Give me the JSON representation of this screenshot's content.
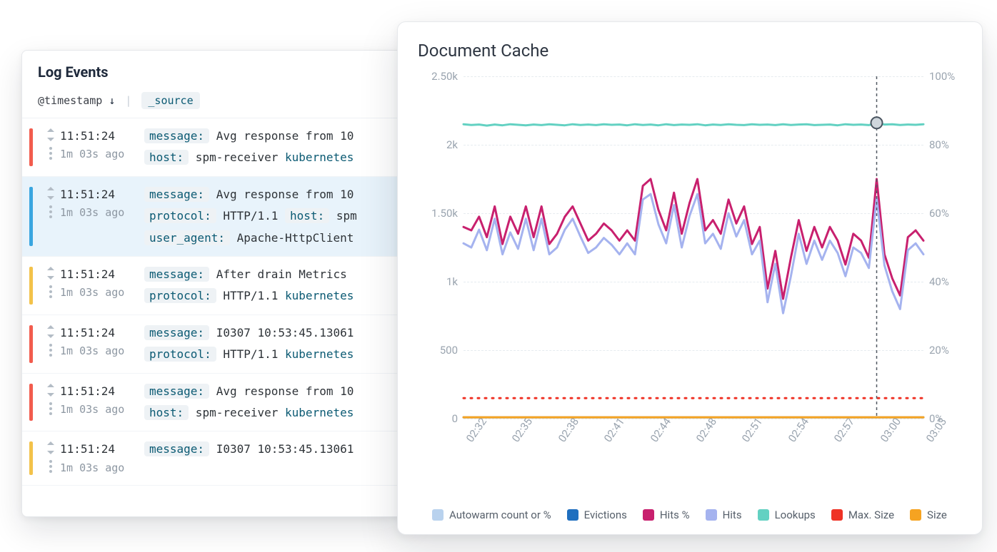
{
  "log_panel": {
    "title": "Log Events",
    "timestamp_label": "@timestamp",
    "sort_arrow": "↓",
    "separator": "|",
    "source_label": "_source",
    "rows": [
      {
        "color": "red",
        "time": "11:51:24",
        "ago": "1m 03s ago",
        "lines": [
          [
            {
              "pill": "message:"
            },
            {
              "text": " Avg response from 10"
            }
          ],
          [
            {
              "pill": "host:"
            },
            {
              "text": " spm-receiver "
            },
            {
              "link": "kubernetes"
            }
          ]
        ]
      },
      {
        "color": "blue",
        "selected": true,
        "time": "11:51:24",
        "ago": "1m 03s ago",
        "lines": [
          [
            {
              "pill": "message:"
            },
            {
              "text": " Avg response from 10"
            }
          ],
          [
            {
              "pill": "protocol:"
            },
            {
              "text": " HTTP/1.1 "
            },
            {
              "pill": "host:"
            },
            {
              "text": " spm"
            }
          ],
          [
            {
              "pill": "user_agent:"
            },
            {
              "text": " Apache-HttpClient"
            }
          ]
        ]
      },
      {
        "color": "yellow",
        "time": "11:51:24",
        "ago": "1m 03s ago",
        "lines": [
          [
            {
              "pill": "message:"
            },
            {
              "text": " After drain Metrics "
            }
          ],
          [
            {
              "pill": "protocol:"
            },
            {
              "text": " HTTP/1.1 "
            },
            {
              "link": "kubernetes"
            }
          ]
        ]
      },
      {
        "color": "red",
        "time": "11:51:24",
        "ago": "1m 03s ago",
        "lines": [
          [
            {
              "pill": "message:"
            },
            {
              "text": " I0307 10:53:45.13061"
            }
          ],
          [
            {
              "pill": "protocol:"
            },
            {
              "text": " HTTP/1.1 "
            },
            {
              "link": "kubernetes"
            }
          ]
        ]
      },
      {
        "color": "red",
        "time": "11:51:24",
        "ago": "1m 03s ago",
        "lines": [
          [
            {
              "pill": "message:"
            },
            {
              "text": " Avg response from 10"
            }
          ],
          [
            {
              "pill": "host:"
            },
            {
              "text": " spm-receiver "
            },
            {
              "link": "kubernetes"
            }
          ]
        ]
      },
      {
        "color": "yellow",
        "time": "11:51:24",
        "ago": "1m 03s ago",
        "lines": [
          [
            {
              "pill": "message:"
            },
            {
              "text": " I0307 10:53:45.13061"
            }
          ]
        ]
      }
    ]
  },
  "chart": {
    "title": "Document Cache",
    "legend": [
      {
        "label": "Autowarm count or %",
        "color": "#b9d2ee"
      },
      {
        "label": "Evictions",
        "color": "#1f6fbf"
      },
      {
        "label": "Hits %",
        "color": "#c8206e"
      },
      {
        "label": "Hits",
        "color": "#a5b3ef"
      },
      {
        "label": "Lookups",
        "color": "#63d1c2"
      },
      {
        "label": "Max. Size",
        "color": "#ef3326"
      },
      {
        "label": "Size",
        "color": "#f6a321"
      }
    ]
  },
  "chart_data": {
    "type": "line",
    "title": "Document Cache",
    "xlabel": "",
    "ylabel_left": "",
    "ylabel_right": "",
    "y1lim": [
      0,
      2500
    ],
    "y2lim": [
      0,
      100
    ],
    "y1_ticks": [
      0,
      500,
      1000,
      1500,
      2000,
      2500
    ],
    "y1_tick_labels": [
      "0",
      "500",
      "1k",
      "1.50k",
      "2k",
      "2.50k"
    ],
    "y2_ticks": [
      0,
      20,
      40,
      60,
      80,
      100
    ],
    "y2_tick_labels": [
      "0%",
      "20%",
      "40%",
      "60%",
      "80%",
      "100%"
    ],
    "x_tick_labels": [
      "02:32",
      "02:35",
      "02:38",
      "02:41",
      "02:44",
      "02:48",
      "02:51",
      "02:54",
      "02:57",
      "03:00",
      "03:03"
    ],
    "cursor_x_index": 53,
    "series": [
      {
        "name": "Lookups",
        "color": "#63d1c2",
        "style": "solid",
        "axis": "left",
        "values": [
          2150,
          2145,
          2148,
          2140,
          2148,
          2142,
          2150,
          2146,
          2142,
          2148,
          2144,
          2150,
          2146,
          2142,
          2150,
          2145,
          2148,
          2144,
          2150,
          2146,
          2148,
          2142,
          2150,
          2145,
          2148,
          2142,
          2150,
          2144,
          2148,
          2146,
          2150,
          2142,
          2148,
          2145,
          2150,
          2146,
          2144,
          2150,
          2146,
          2148,
          2144,
          2150,
          2145,
          2148,
          2150,
          2144,
          2146,
          2148,
          2142,
          2150,
          2146,
          2148,
          2144,
          2160,
          2148,
          2150,
          2145,
          2148,
          2146,
          2150
        ]
      },
      {
        "name": "Hits %",
        "color": "#c8206e",
        "style": "solid",
        "axis": "right",
        "values": [
          56,
          55,
          59,
          53,
          62,
          51,
          59,
          54,
          62,
          53,
          62,
          51,
          54,
          59,
          62,
          57,
          52,
          54,
          57,
          55,
          52,
          55,
          52,
          68,
          70,
          61,
          55,
          66,
          54,
          63,
          70,
          55,
          58,
          54,
          64,
          57,
          62,
          51,
          56,
          38,
          49,
          35,
          47,
          58,
          49,
          56,
          50,
          56,
          52,
          45,
          54,
          52,
          47,
          70,
          48,
          41,
          36,
          53,
          55,
          52
        ]
      },
      {
        "name": "Hits",
        "color": "#a5b3ef",
        "style": "solid",
        "axis": "left",
        "values": [
          1280,
          1250,
          1380,
          1230,
          1460,
          1200,
          1360,
          1240,
          1460,
          1230,
          1460,
          1200,
          1250,
          1380,
          1460,
          1330,
          1210,
          1250,
          1320,
          1270,
          1200,
          1280,
          1200,
          1600,
          1640,
          1420,
          1280,
          1560,
          1250,
          1480,
          1640,
          1280,
          1350,
          1240,
          1500,
          1330,
          1450,
          1200,
          1300,
          850,
          1130,
          770,
          1040,
          1350,
          1130,
          1300,
          1160,
          1300,
          1210,
          1040,
          1250,
          1210,
          1100,
          1610,
          1120,
          930,
          800,
          1230,
          1280,
          1200
        ]
      },
      {
        "name": "Max. Size",
        "color": "#ef3326",
        "style": "dotted",
        "axis": "left",
        "values": [
          150,
          150,
          150,
          150,
          150,
          150,
          150,
          150,
          150,
          150,
          150,
          150,
          150,
          150,
          150,
          150,
          150,
          150,
          150,
          150,
          150,
          150,
          150,
          150,
          150,
          150,
          150,
          150,
          150,
          150,
          150,
          150,
          150,
          150,
          150,
          150,
          150,
          150,
          150,
          150,
          150,
          150,
          150,
          150,
          150,
          150,
          150,
          150,
          150,
          150,
          150,
          150,
          150,
          150,
          150,
          150,
          150,
          150,
          150,
          150
        ]
      },
      {
        "name": "Evictions",
        "color": "#1f6fbf",
        "style": "solid",
        "axis": "left",
        "values": [
          10,
          10,
          10,
          10,
          10,
          10,
          10,
          10,
          10,
          10,
          10,
          10,
          10,
          10,
          10,
          10,
          10,
          10,
          10,
          10,
          10,
          10,
          10,
          10,
          10,
          10,
          10,
          10,
          10,
          10,
          10,
          10,
          10,
          10,
          10,
          10,
          10,
          10,
          10,
          10,
          10,
          10,
          10,
          10,
          10,
          10,
          10,
          10,
          10,
          10,
          10,
          10,
          10,
          10,
          10,
          10,
          10,
          10,
          10,
          10
        ]
      },
      {
        "name": "Autowarm count or %",
        "color": "#b9d2ee",
        "style": "solid",
        "axis": "left",
        "values": [
          10,
          10,
          10,
          10,
          10,
          10,
          10,
          10,
          10,
          10,
          10,
          10,
          10,
          10,
          10,
          10,
          10,
          10,
          10,
          10,
          10,
          10,
          10,
          10,
          10,
          10,
          10,
          10,
          10,
          10,
          10,
          10,
          10,
          10,
          10,
          10,
          10,
          10,
          10,
          10,
          10,
          10,
          10,
          10,
          10,
          10,
          10,
          10,
          10,
          10,
          10,
          10,
          10,
          10,
          10,
          10,
          10,
          10,
          10,
          10
        ]
      },
      {
        "name": "Size",
        "color": "#f6a321",
        "style": "solid",
        "axis": "left",
        "values": [
          10,
          10,
          10,
          10,
          10,
          10,
          10,
          10,
          10,
          10,
          10,
          10,
          10,
          10,
          10,
          10,
          10,
          10,
          10,
          10,
          10,
          10,
          10,
          10,
          10,
          10,
          10,
          10,
          10,
          10,
          10,
          10,
          10,
          10,
          10,
          10,
          10,
          10,
          10,
          10,
          10,
          10,
          10,
          10,
          10,
          10,
          10,
          10,
          10,
          10,
          10,
          10,
          10,
          10,
          10,
          10,
          10,
          10,
          10,
          10
        ]
      }
    ]
  }
}
